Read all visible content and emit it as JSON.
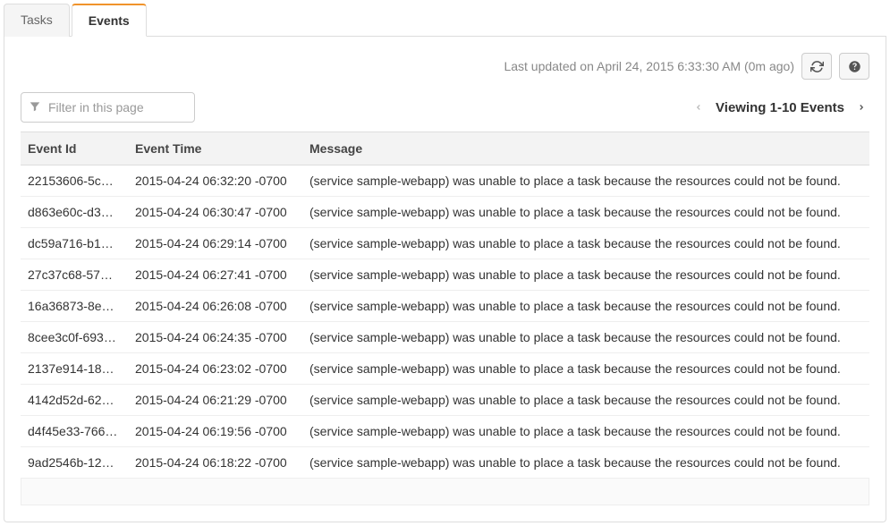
{
  "tabs": {
    "tasks": "Tasks",
    "events": "Events"
  },
  "status": {
    "last_updated": "Last updated on April 24, 2015 6:33:30 AM (0m ago)"
  },
  "filter": {
    "placeholder": "Filter in this page"
  },
  "pager": {
    "label": "Viewing 1-10 Events"
  },
  "table": {
    "headers": {
      "event_id": "Event Id",
      "event_time": "Event Time",
      "message": "Message"
    },
    "rows": [
      {
        "id": "22153606-5c…",
        "time": "2015-04-24 06:32:20 -0700",
        "msg": "(service sample-webapp) was unable to place a task because the resources could not be found."
      },
      {
        "id": "d863e60c-d3…",
        "time": "2015-04-24 06:30:47 -0700",
        "msg": "(service sample-webapp) was unable to place a task because the resources could not be found."
      },
      {
        "id": "dc59a716-b1…",
        "time": "2015-04-24 06:29:14 -0700",
        "msg": "(service sample-webapp) was unable to place a task because the resources could not be found."
      },
      {
        "id": "27c37c68-57…",
        "time": "2015-04-24 06:27:41 -0700",
        "msg": "(service sample-webapp) was unable to place a task because the resources could not be found."
      },
      {
        "id": "16a36873-8e…",
        "time": "2015-04-24 06:26:08 -0700",
        "msg": "(service sample-webapp) was unable to place a task because the resources could not be found."
      },
      {
        "id": "8cee3c0f-693…",
        "time": "2015-04-24 06:24:35 -0700",
        "msg": "(service sample-webapp) was unable to place a task because the resources could not be found."
      },
      {
        "id": "2137e914-18…",
        "time": "2015-04-24 06:23:02 -0700",
        "msg": "(service sample-webapp) was unable to place a task because the resources could not be found."
      },
      {
        "id": "4142d52d-62…",
        "time": "2015-04-24 06:21:29 -0700",
        "msg": "(service sample-webapp) was unable to place a task because the resources could not be found."
      },
      {
        "id": "d4f45e33-766…",
        "time": "2015-04-24 06:19:56 -0700",
        "msg": "(service sample-webapp) was unable to place a task because the resources could not be found."
      },
      {
        "id": "9ad2546b-12…",
        "time": "2015-04-24 06:18:22 -0700",
        "msg": "(service sample-webapp) was unable to place a task because the resources could not be found."
      }
    ]
  }
}
